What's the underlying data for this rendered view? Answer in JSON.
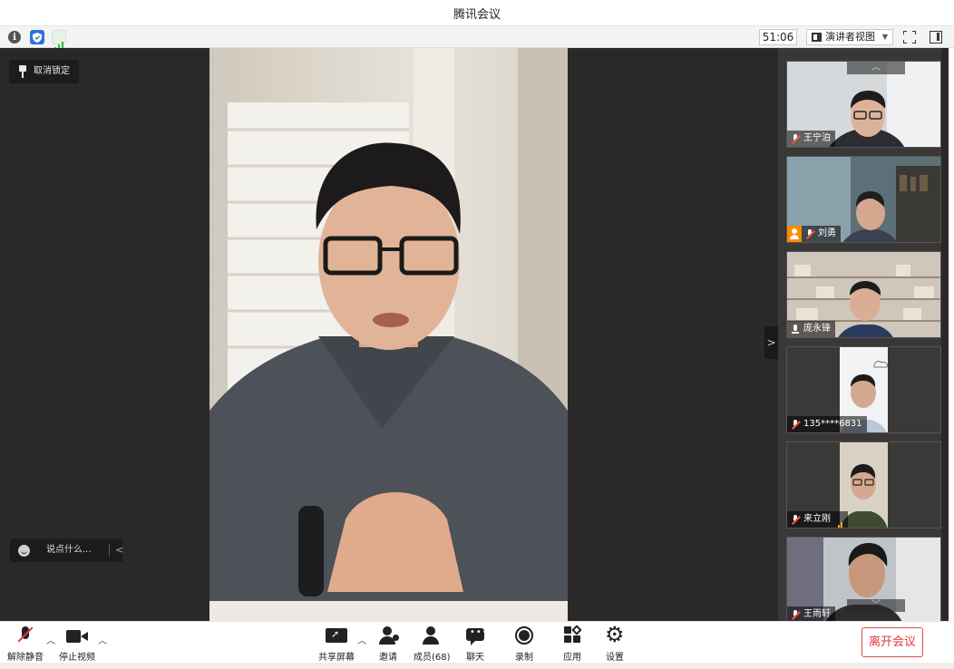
{
  "window": {
    "title": "腾讯会议"
  },
  "status": {
    "timer": "51:06",
    "view_mode": "演讲者视图"
  },
  "stage": {
    "unpin_label": "取消锁定",
    "chat_placeholder": "说点什么..."
  },
  "participants": [
    {
      "name": "王宁泊",
      "mic": "muted"
    },
    {
      "name": "刘勇",
      "mic": "muted",
      "host": true
    },
    {
      "name": "庞永锋",
      "mic": "on"
    },
    {
      "name": "135****6831",
      "mic": "muted"
    },
    {
      "name": "来立刚",
      "mic": "muted",
      "network_bars": 3
    },
    {
      "name": "王雨轩",
      "mic": "muted"
    }
  ],
  "toolbar": {
    "unmute": "解除静音",
    "stop_video": "停止视频",
    "share_screen": "共享屏幕",
    "invite": "邀请",
    "members": "成员(68)",
    "chat": "聊天",
    "record": "录制",
    "apps": "应用",
    "settings": "设置",
    "leave": "离开会议"
  },
  "colors": {
    "stage_bg": "#2b2928",
    "leave_red": "#e03a3a",
    "accent_blue": "#2f6fe4",
    "host_orange": "#ff8a00"
  }
}
